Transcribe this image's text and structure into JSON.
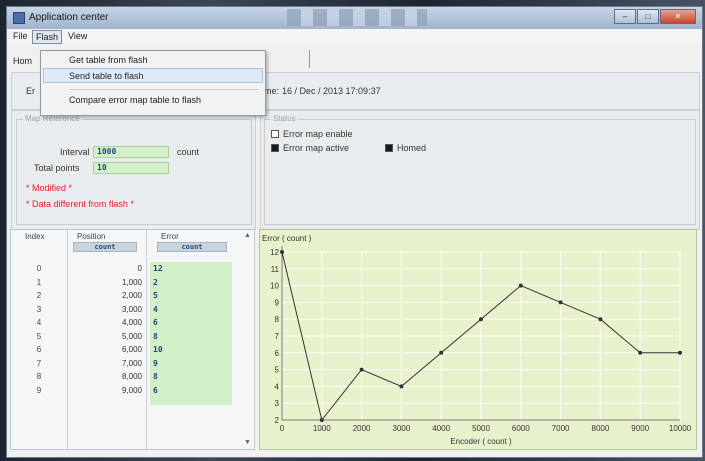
{
  "window": {
    "title": "Application center"
  },
  "menu": {
    "file": "File",
    "flash": "Flash",
    "view": "View"
  },
  "tab": {
    "home": "Hom"
  },
  "flash_menu": {
    "items": [
      "Get table from flash",
      "Send table to flash",
      "Compare error map table to flash"
    ]
  },
  "info": {
    "time_label": "me:",
    "time_value": "16 / Dec / 2013  17:09:37",
    "left_fragment": "Er"
  },
  "map_group": {
    "title": "Map Reference",
    "interval_label": "Interval",
    "interval_value": "1000",
    "interval_unit": "count",
    "total_label": "Total points",
    "total_value": "10",
    "modified": "* Modified *",
    "diff": "* Data different from flash *"
  },
  "status_group": {
    "title": "Status",
    "enable": "Error map enable",
    "active": "Error map active",
    "homed": "Homed"
  },
  "table": {
    "headers": {
      "index": "Index",
      "position": "Position",
      "error": "Error"
    },
    "units": {
      "position": "count",
      "error": "count"
    },
    "rows": [
      {
        "index": "0",
        "position": "0",
        "error": "12"
      },
      {
        "index": "1",
        "position": "1,000",
        "error": "2"
      },
      {
        "index": "2",
        "position": "2,000",
        "error": "5"
      },
      {
        "index": "3",
        "position": "3,000",
        "error": "4"
      },
      {
        "index": "4",
        "position": "4,000",
        "error": "6"
      },
      {
        "index": "5",
        "position": "5,000",
        "error": "8"
      },
      {
        "index": "6",
        "position": "6,000",
        "error": "10"
      },
      {
        "index": "7",
        "position": "7,000",
        "error": "9"
      },
      {
        "index": "8",
        "position": "8,000",
        "error": "8"
      },
      {
        "index": "9",
        "position": "9,000",
        "error": "6"
      }
    ]
  },
  "chart_data": {
    "type": "line",
    "title": "",
    "ylabel": "Error ( count )",
    "xlabel": "Encoder ( count )",
    "x": [
      0,
      1000,
      2000,
      3000,
      4000,
      5000,
      6000,
      7000,
      8000,
      9000,
      10000
    ],
    "values": [
      12,
      2,
      5,
      4,
      6,
      8,
      10,
      9,
      8,
      6,
      6
    ],
    "xlim": [
      0,
      10000
    ],
    "ylim": [
      2,
      12
    ],
    "x_ticks": [
      "0",
      "1000",
      "2000",
      "3000",
      "4000",
      "5000",
      "6000",
      "7000",
      "8000",
      "9000",
      "10000"
    ],
    "y_ticks": [
      "2",
      "3",
      "4",
      "5",
      "6",
      "7",
      "8",
      "9",
      "10",
      "11",
      "12"
    ],
    "grid": true,
    "background": "#e7f2cc",
    "grid_color": "#f8fcef",
    "line_color": "#333333"
  }
}
